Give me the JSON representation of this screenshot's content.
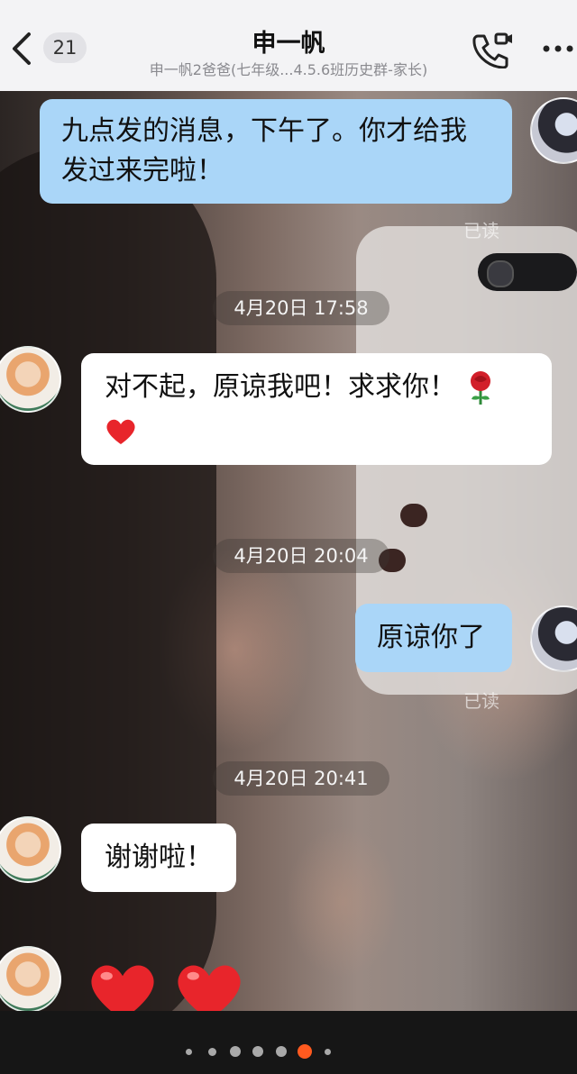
{
  "header": {
    "unread_count": "21",
    "title": "申一帆",
    "subtitle": "申一帆2爸爸(七年级...4.5.6班历史群-家长)"
  },
  "icons": {
    "back": "back-chevron-icon",
    "call": "phone-call-icon",
    "more": "more-icon",
    "rose": "rose-icon",
    "heart": "heart-icon"
  },
  "messages": [
    {
      "direction": "outgoing",
      "text_line1": "九点发的消息，下午了。你才给我",
      "text_line2": "发过来完啦！",
      "status": "已读"
    },
    {
      "timestamp": "4月20日 17:58"
    },
    {
      "direction": "incoming",
      "text": "对不起，原谅我吧！求求你！"
    },
    {
      "timestamp": "4月20日 20:04"
    },
    {
      "direction": "outgoing",
      "text": "原谅你了",
      "status": "已读"
    },
    {
      "timestamp": "4月20日 20:41"
    },
    {
      "direction": "incoming",
      "text": "谢谢啦！"
    }
  ],
  "colors": {
    "outgoing_bubble": "#aad6f8",
    "incoming_bubble": "#ffffff",
    "heart": "#e8252b",
    "active_dot": "#ff5a1f"
  },
  "pagination": {
    "total": 7,
    "active_index": 5
  }
}
